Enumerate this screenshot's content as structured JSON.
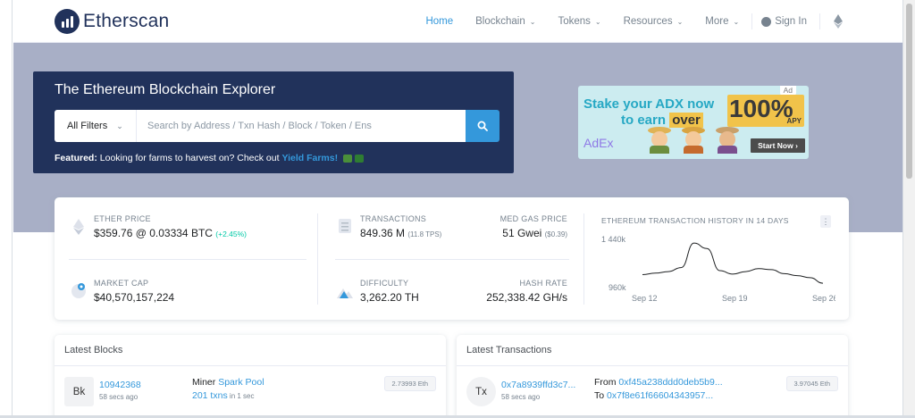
{
  "brand": {
    "name": "Etherscan"
  },
  "nav": {
    "items": [
      {
        "label": "Home",
        "active": true
      },
      {
        "label": "Blockchain",
        "dropdown": true
      },
      {
        "label": "Tokens",
        "dropdown": true
      },
      {
        "label": "Resources",
        "dropdown": true
      },
      {
        "label": "More",
        "dropdown": true
      }
    ],
    "signin": "Sign In"
  },
  "hero": {
    "title": "The Ethereum Blockchain Explorer",
    "filter": "All Filters",
    "search_placeholder": "Search by Address / Txn Hash / Block / Token / Ens",
    "featured_label": "Featured:",
    "featured_text": " Looking for farms to harvest on? Check out ",
    "featured_link": "Yield Farms!"
  },
  "ad": {
    "badge": "Ad",
    "line1": "Stake your ADX now",
    "line2_pre": "to earn ",
    "line2_highlight": "over",
    "percent": "100%",
    "apy": "APY",
    "brand": "AdEx",
    "cta": "Start Now ›"
  },
  "stats": {
    "ether_price": {
      "label": "ETHER PRICE",
      "value": "$359.76 @ 0.03334 BTC",
      "change": "(+2.45%)"
    },
    "market_cap": {
      "label": "MARKET CAP",
      "value": "$40,570,157,224"
    },
    "transactions": {
      "label": "TRANSACTIONS",
      "value": "849.36 M",
      "tps": "(11.8 TPS)"
    },
    "med_gas": {
      "label": "MED GAS PRICE",
      "value": "51 Gwei",
      "usd": "($0.39)"
    },
    "difficulty": {
      "label": "DIFFICULTY",
      "value": "3,262.20 TH"
    },
    "hash_rate": {
      "label": "HASH RATE",
      "value": "252,338.42 GH/s"
    }
  },
  "chart_data": {
    "type": "line",
    "title": "ETHEREUM TRANSACTION HISTORY IN 14 DAYS",
    "x": [
      "Sep 12",
      "Sep 13",
      "Sep 14",
      "Sep 15",
      "Sep 16",
      "Sep 17",
      "Sep 18",
      "Sep 19",
      "Sep 20",
      "Sep 21",
      "Sep 22",
      "Sep 23",
      "Sep 24",
      "Sep 25",
      "Sep 26"
    ],
    "values": [
      1080,
      1095,
      1110,
      1150,
      1395,
      1340,
      1120,
      1085,
      1110,
      1140,
      1130,
      1090,
      1070,
      1050,
      995
    ],
    "x_ticks": [
      "Sep 12",
      "Sep 19",
      "Sep 26"
    ],
    "y_ticks": [
      "1 440k",
      "960k"
    ],
    "ylim": [
      960,
      1440
    ]
  },
  "latest_blocks": {
    "title": "Latest Blocks",
    "rows": [
      {
        "avatar": "Bk",
        "block": "10942368",
        "age": "58 secs ago",
        "miner_label": "Miner ",
        "miner": "Spark Pool",
        "txns": "201 txns",
        "txns_time": " in 1 sec",
        "amount": "2.73993 Eth"
      }
    ]
  },
  "latest_transactions": {
    "title": "Latest Transactions",
    "rows": [
      {
        "avatar": "Tx",
        "hash": "0x7a8939ffd3c7...",
        "age": "58 secs ago",
        "from_label": "From ",
        "from": "0xf45a238ddd0deb5b9...",
        "to_label": "To ",
        "to": "0x7f8e61f66604343957...",
        "amount": "3.97045 Eth"
      }
    ]
  }
}
